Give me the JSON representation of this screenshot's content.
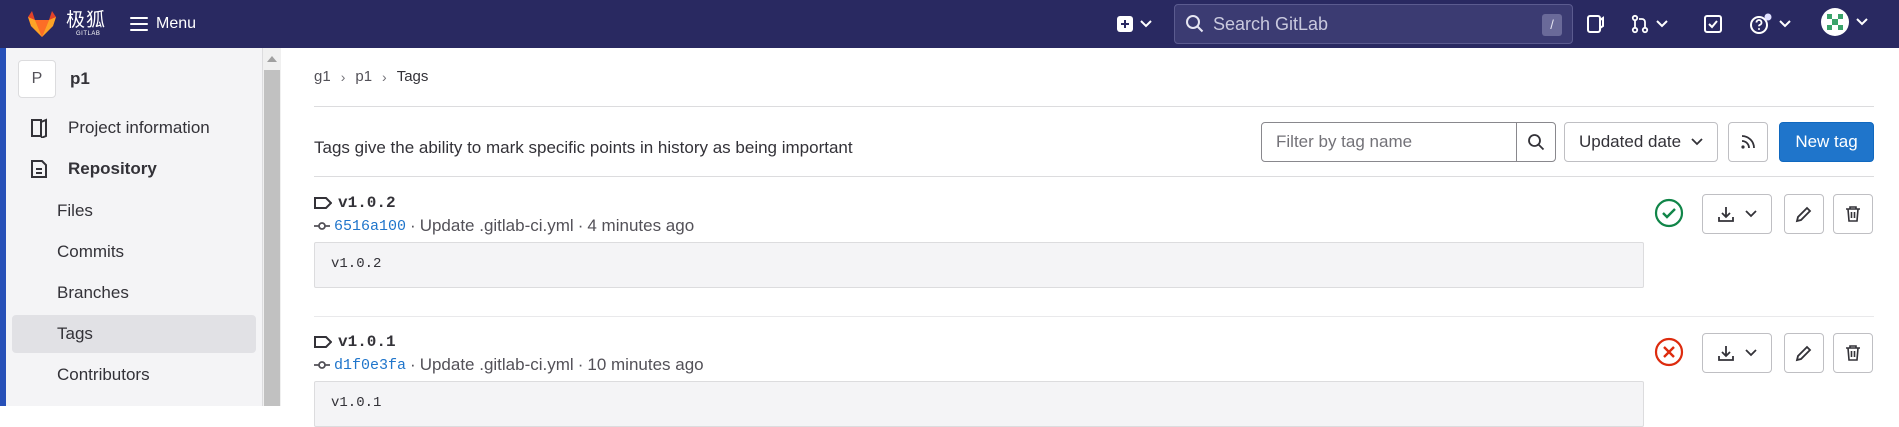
{
  "navbar": {
    "logo_text": "极狐",
    "logo_sub": "GITLAB",
    "menu_label": "Menu",
    "search_placeholder": "Search GitLab",
    "search_shortcut": "/"
  },
  "sidebar": {
    "project_avatar": "P",
    "project_name": "p1",
    "items": [
      {
        "label": "Project information",
        "icon": "project-info-icon"
      },
      {
        "label": "Repository",
        "icon": "repository-icon"
      }
    ],
    "sub_items": [
      {
        "label": "Files"
      },
      {
        "label": "Commits"
      },
      {
        "label": "Branches"
      },
      {
        "label": "Tags",
        "active": true
      },
      {
        "label": "Contributors"
      }
    ]
  },
  "breadcrumb": [
    "g1",
    "p1",
    "Tags"
  ],
  "intro_text": "Tags give the ability to mark specific points in history as being important",
  "toolbar": {
    "filter_placeholder": "Filter by tag name",
    "sort_label": "Updated date",
    "new_tag_label": "New tag"
  },
  "tags": [
    {
      "name": "v1.0.2",
      "sha": "6516a100",
      "commit_title": "Update .gitlab-ci.yml",
      "time": "4 minutes ago",
      "message": "v1.0.2",
      "pipeline_status": "success",
      "status_color": "#108548"
    },
    {
      "name": "v1.0.1",
      "sha": "d1f0e3fa",
      "commit_title": "Update .gitlab-ci.yml",
      "time": "10 minutes ago",
      "message": "v1.0.1",
      "pipeline_status": "failed",
      "status_color": "#dd2b0e"
    }
  ],
  "colors": {
    "navbar": "#292961",
    "primary": "#1f75cb",
    "success": "#108548",
    "danger": "#dd2b0e"
  }
}
